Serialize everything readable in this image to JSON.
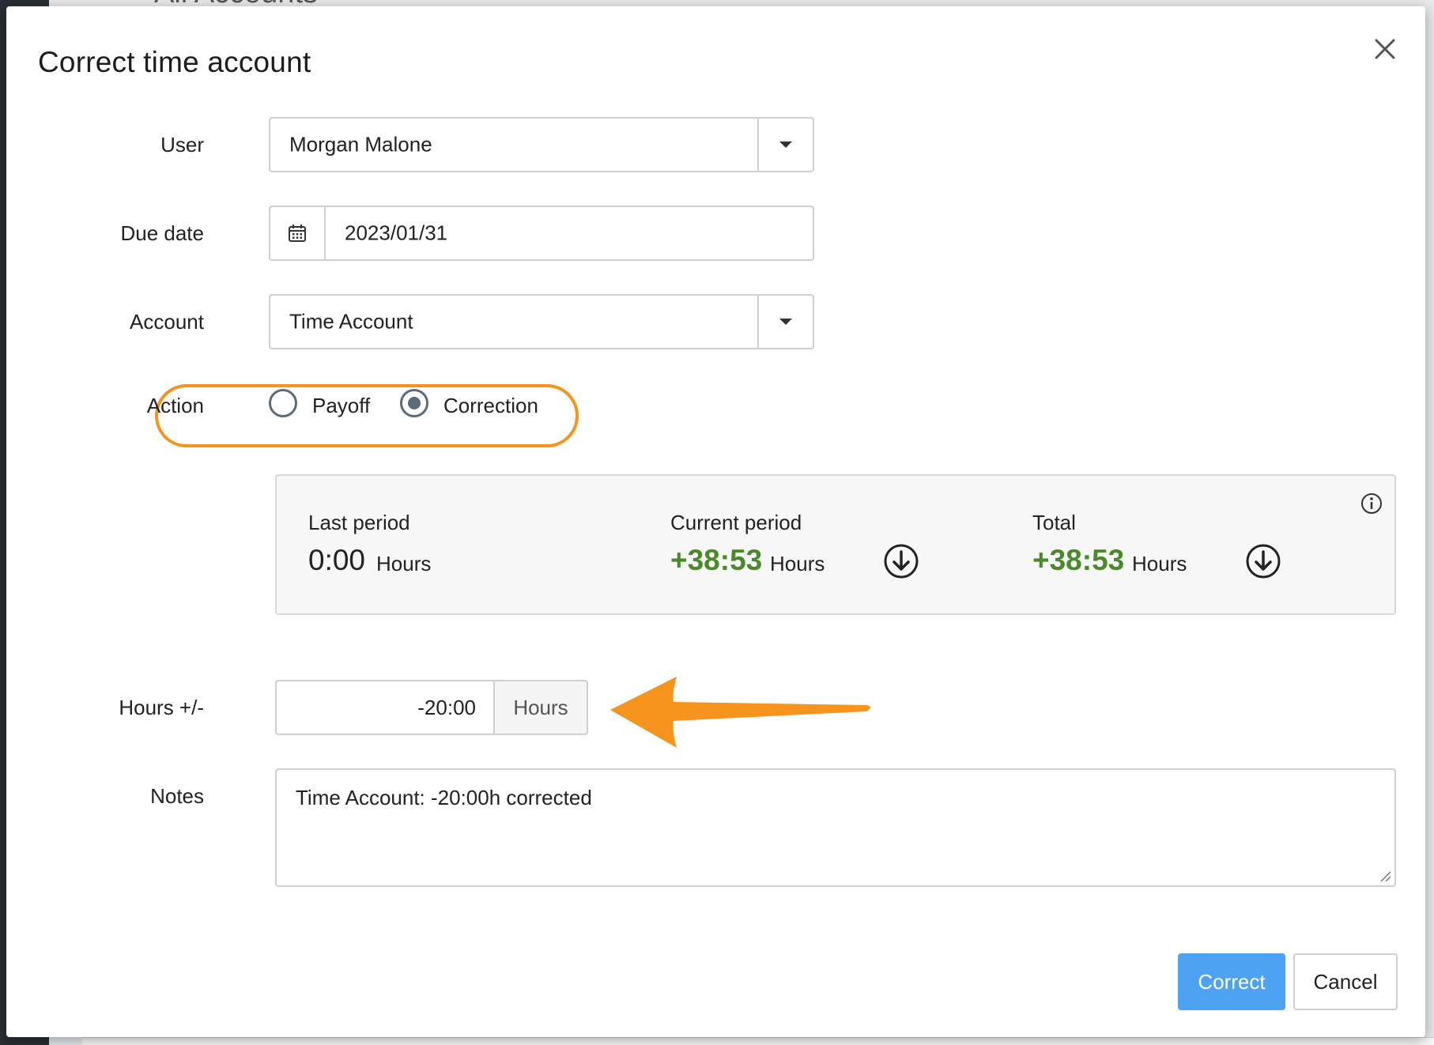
{
  "background": {
    "page_title": "All Accounts"
  },
  "modal": {
    "title": "Correct time account",
    "close_icon": "close-icon"
  },
  "form": {
    "user": {
      "label": "User",
      "value": "Morgan Malone"
    },
    "due_date": {
      "label": "Due date",
      "value": "2023/01/31",
      "icon": "calendar-icon"
    },
    "account": {
      "label": "Account",
      "value": "Time Account"
    },
    "action": {
      "label": "Action",
      "options": [
        {
          "label": "Payoff",
          "checked": false
        },
        {
          "label": "Correction",
          "checked": true
        }
      ]
    },
    "hours": {
      "label": "Hours +/-",
      "value": "-20:00",
      "unit": "Hours"
    },
    "notes": {
      "label": "Notes",
      "value": "Time Account: -20:00h corrected"
    }
  },
  "summary": {
    "last_period": {
      "label": "Last period",
      "value": "0:00",
      "unit": "Hours"
    },
    "current_period": {
      "label": "Current period",
      "value": "+38:53",
      "unit": "Hours"
    },
    "total": {
      "label": "Total",
      "value": "+38:53",
      "unit": "Hours"
    }
  },
  "buttons": {
    "correct": "Correct",
    "cancel": "Cancel"
  },
  "colors": {
    "highlight": "#f7941d",
    "primary": "#4da3f2",
    "positive": "#4a8a2a",
    "radio": "#5b6b78"
  }
}
